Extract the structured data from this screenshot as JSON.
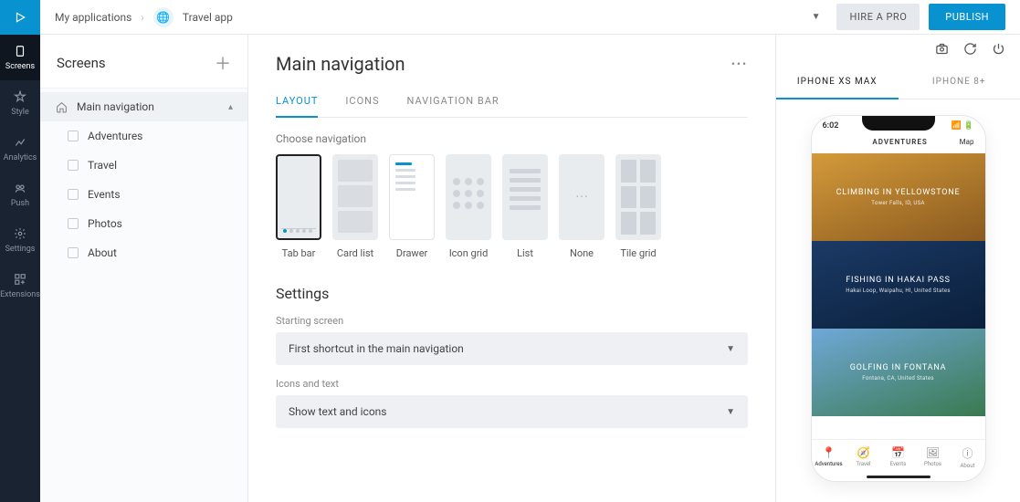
{
  "rail": {
    "items": [
      {
        "label": "Screens"
      },
      {
        "label": "Style"
      },
      {
        "label": "Analytics"
      },
      {
        "label": "Push"
      },
      {
        "label": "Settings"
      },
      {
        "label": "Extensions"
      }
    ]
  },
  "breadcrumb": {
    "root": "My applications",
    "app": "Travel app"
  },
  "topbar": {
    "hire": "HIRE A PRO",
    "publish": "PUBLISH"
  },
  "screens": {
    "title": "Screens",
    "items": [
      {
        "label": "Main navigation"
      },
      {
        "label": "Adventures"
      },
      {
        "label": "Travel"
      },
      {
        "label": "Events"
      },
      {
        "label": "Photos"
      },
      {
        "label": "About"
      }
    ]
  },
  "editor": {
    "title": "Main navigation",
    "tabs": {
      "layout": "LAYOUT",
      "icons": "ICONS",
      "navbar": "NAVIGATION BAR"
    },
    "choose_label": "Choose navigation",
    "nav_options": [
      {
        "label": "Tab bar"
      },
      {
        "label": "Card list"
      },
      {
        "label": "Drawer"
      },
      {
        "label": "Icon grid"
      },
      {
        "label": "List"
      },
      {
        "label": "None"
      },
      {
        "label": "Tile grid"
      }
    ],
    "settings_title": "Settings",
    "starting_label": "Starting screen",
    "starting_value": "First shortcut in the main navigation",
    "icons_label": "Icons and text",
    "icons_value": "Show text and icons"
  },
  "preview": {
    "tabs": {
      "xsmax": "IPHONE XS MAX",
      "eight": "IPHONE 8+"
    },
    "status_time": "6:02",
    "header_title": "ADVENTURES",
    "header_right": "Map",
    "cards": [
      {
        "title": "CLIMBING IN YELLOWSTONE",
        "sub": "Tower Falls, ID, USA"
      },
      {
        "title": "FISHING IN HAKAI PASS",
        "sub": "Hakai Loop, Waipahu, HI, United States"
      },
      {
        "title": "GOLFING IN FONTANA",
        "sub": "Fontana, CA, United States"
      }
    ],
    "tabbar": [
      {
        "label": "Adventures"
      },
      {
        "label": "Travel"
      },
      {
        "label": "Events"
      },
      {
        "label": "Photos"
      },
      {
        "label": "About"
      }
    ]
  }
}
